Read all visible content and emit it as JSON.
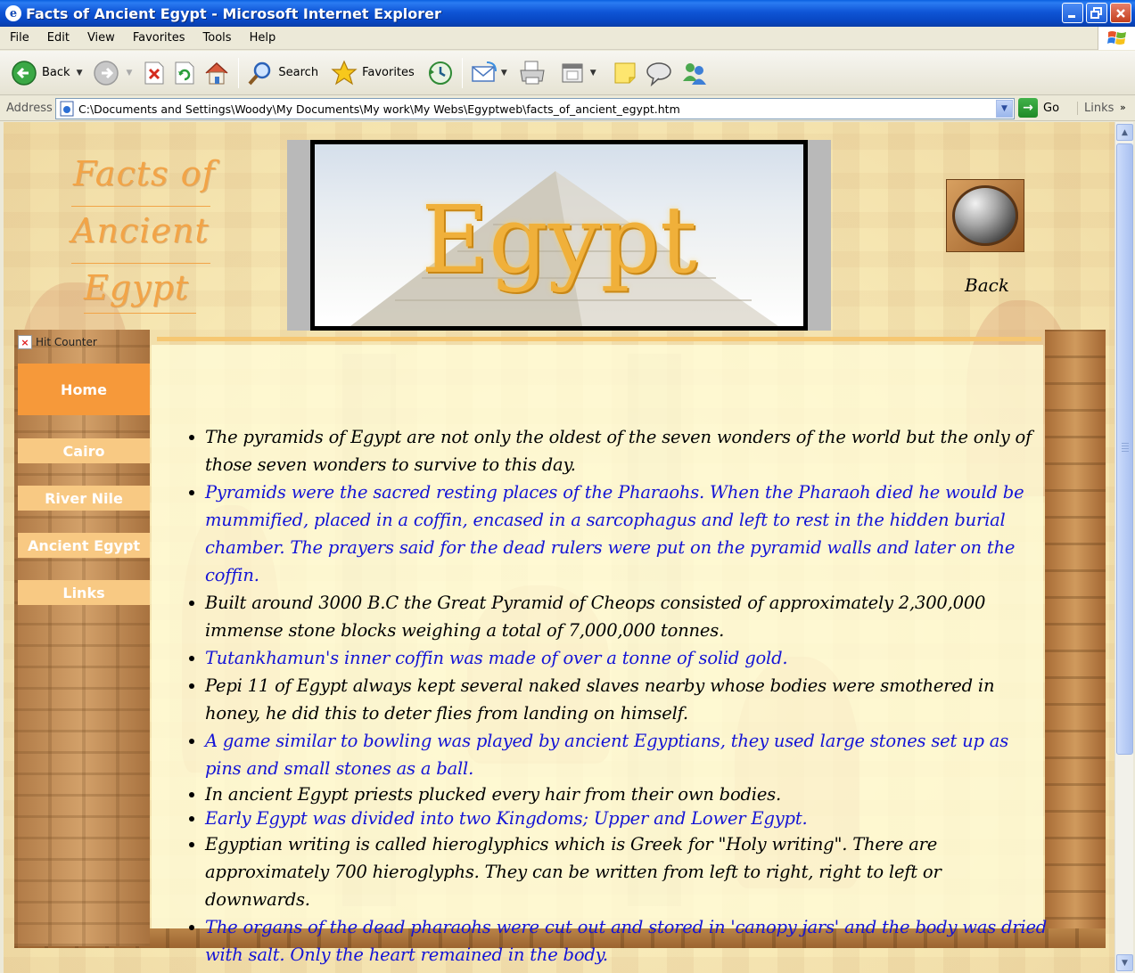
{
  "window": {
    "title": "Facts of Ancient Egypt - Microsoft Internet Explorer",
    "app_icon": "ie-icon"
  },
  "menu": [
    "File",
    "Edit",
    "View",
    "Favorites",
    "Tools",
    "Help"
  ],
  "toolbar": {
    "back_label": "Back",
    "search_label": "Search",
    "favorites_label": "Favorites"
  },
  "address": {
    "label": "Address",
    "url": "C:\\Documents and Settings\\Woody\\My Documents\\My work\\My Webs\\Egyptweb\\facts_of_ancient_egypt.htm",
    "go_label": "Go",
    "links_label": "Links"
  },
  "page": {
    "logo_words": [
      "Facts of",
      "Ancient",
      "Egypt"
    ],
    "banner_title": "Egypt",
    "back_label": "Back",
    "hit_counter": "Hit Counter",
    "nav": {
      "home": "Home",
      "items": [
        "Cairo",
        "River Nile",
        "Ancient Egypt",
        "Links"
      ]
    },
    "facts": [
      {
        "text": "The pyramids of Egypt are not only the oldest of the seven wonders of the world but the only of those seven wonders to survive to this day.",
        "color": "black"
      },
      {
        "text": "Pyramids were the sacred resting places of the Pharaohs. When the Pharaoh died he would be mummified, placed in a coffin, encased in a sarcophagus and left to rest in the hidden burial chamber. The prayers said for the dead rulers were put on the pyramid walls and later on the coffin.",
        "color": "blue"
      },
      {
        "text": "Built around 3000 B.C the Great Pyramid of Cheops consisted of approximately 2,300,000 immense stone blocks weighing a total of 7,000,000 tonnes.",
        "color": "black"
      },
      {
        "text": "Tutankhamun's inner coffin was made of over a tonne of solid gold.",
        "color": "blue"
      },
      {
        "text": "Pepi 11 of Egypt always kept several naked slaves nearby whose bodies were smothered in honey, he did this to deter flies from landing on himself.",
        "color": "black"
      },
      {
        "text": "A game similar to bowling was played by ancient Egyptians, they used large stones set up as pins and small stones as a ball.",
        "color": "blue"
      },
      {
        "text": "In ancient Egypt priests plucked every hair from their own bodies.",
        "color": "black"
      },
      {
        "text": "Early Egypt was divided into two Kingdoms; Upper and Lower Egypt.",
        "color": "blue"
      },
      {
        "text": "Egyptian writing is called hieroglyphics which is Greek for \"Holy writing\". There are approximately 700 hieroglyphs. They can be written from left to right, right to left or downwards.",
        "color": "black"
      },
      {
        "text": "The organs of the dead pharaohs were cut out and stored in 'canopy jars' and the body was dried with salt. Only the heart remained in the body.",
        "color": "blue"
      }
    ]
  },
  "colors": {
    "fact_black": "#000000",
    "fact_blue": "#1414d6",
    "nav_home": "#f6993a",
    "nav_item": "#f8c983",
    "logo_orange": "#f2a447"
  }
}
